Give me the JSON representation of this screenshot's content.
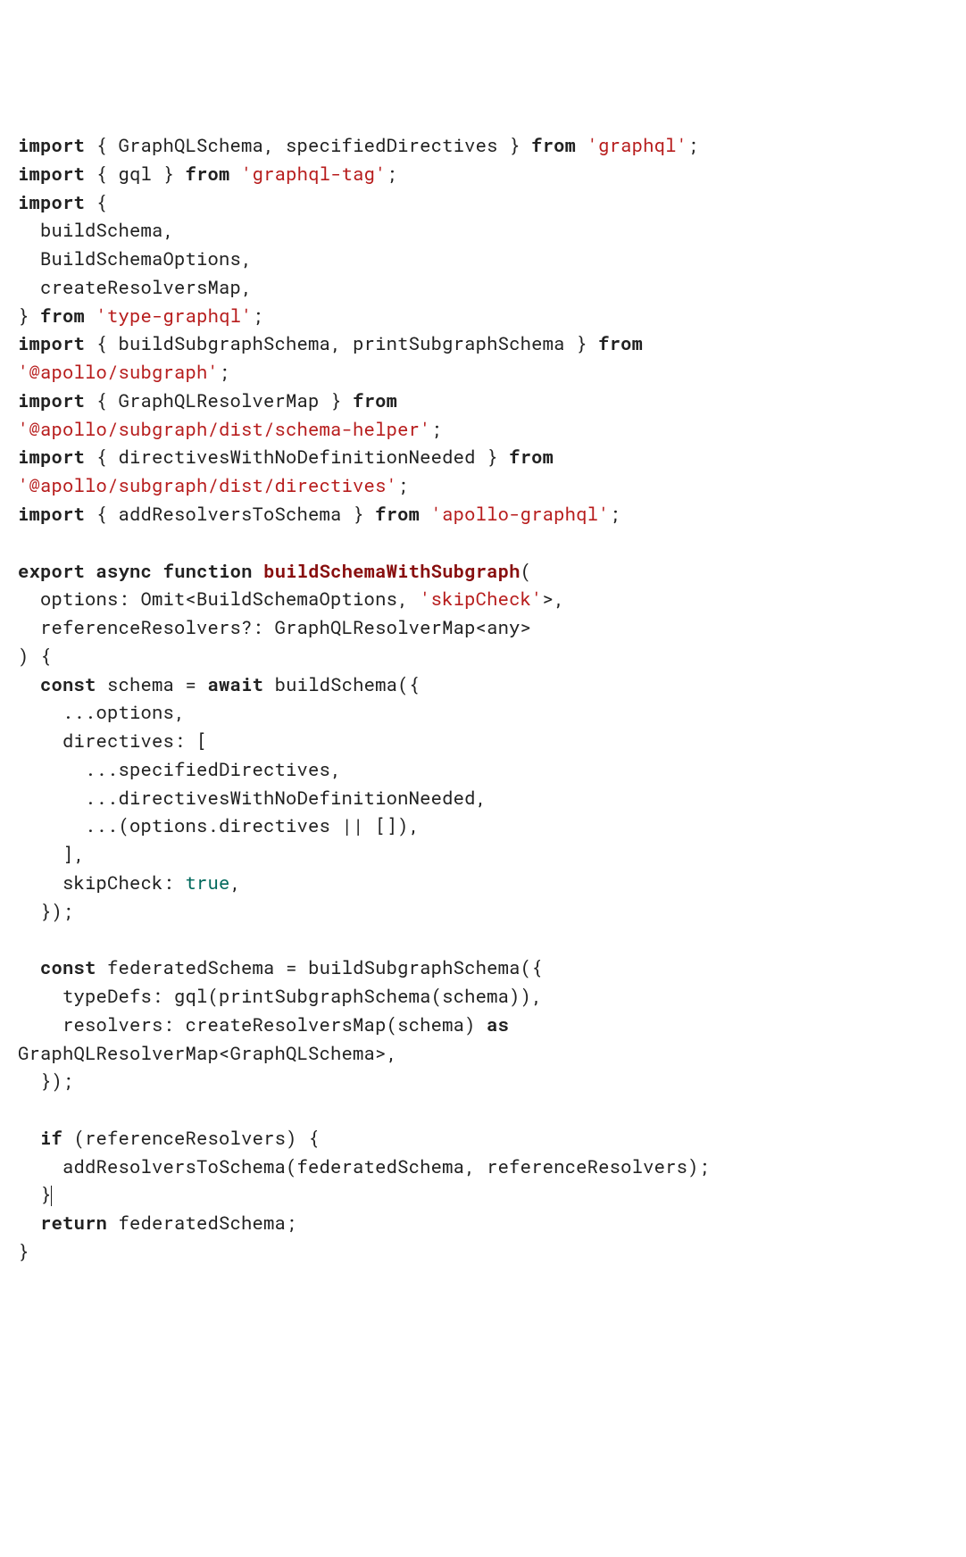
{
  "tokens": [
    {
      "t": "import",
      "c": "kw"
    },
    {
      "t": " { GraphQLSchema, specifiedDirectives } ",
      "c": ""
    },
    {
      "t": "from",
      "c": "kw"
    },
    {
      "t": " ",
      "c": ""
    },
    {
      "t": "'graphql'",
      "c": "str"
    },
    {
      "t": ";",
      "c": ""
    },
    {
      "t": "\n",
      "c": ""
    },
    {
      "t": "import",
      "c": "kw"
    },
    {
      "t": " { gql } ",
      "c": ""
    },
    {
      "t": "from",
      "c": "kw"
    },
    {
      "t": " ",
      "c": ""
    },
    {
      "t": "'graphql-tag'",
      "c": "str"
    },
    {
      "t": ";",
      "c": ""
    },
    {
      "t": "\n",
      "c": ""
    },
    {
      "t": "import",
      "c": "kw"
    },
    {
      "t": " {",
      "c": ""
    },
    {
      "t": "\n",
      "c": ""
    },
    {
      "t": "  buildSchema,",
      "c": ""
    },
    {
      "t": "\n",
      "c": ""
    },
    {
      "t": "  BuildSchemaOptions,",
      "c": ""
    },
    {
      "t": "\n",
      "c": ""
    },
    {
      "t": "  createResolversMap,",
      "c": ""
    },
    {
      "t": "\n",
      "c": ""
    },
    {
      "t": "} ",
      "c": ""
    },
    {
      "t": "from",
      "c": "kw"
    },
    {
      "t": " ",
      "c": ""
    },
    {
      "t": "'type-graphql'",
      "c": "str"
    },
    {
      "t": ";",
      "c": ""
    },
    {
      "t": "\n",
      "c": ""
    },
    {
      "t": "import",
      "c": "kw"
    },
    {
      "t": " { buildSubgraphSchema, printSubgraphSchema } ",
      "c": ""
    },
    {
      "t": "from",
      "c": "kw"
    },
    {
      "t": "\n",
      "c": ""
    },
    {
      "t": "'@apollo/subgraph'",
      "c": "str"
    },
    {
      "t": ";",
      "c": ""
    },
    {
      "t": "\n",
      "c": ""
    },
    {
      "t": "import",
      "c": "kw"
    },
    {
      "t": " { GraphQLResolverMap } ",
      "c": ""
    },
    {
      "t": "from",
      "c": "kw"
    },
    {
      "t": "\n",
      "c": ""
    },
    {
      "t": "'@apollo/subgraph/dist/schema-helper'",
      "c": "str"
    },
    {
      "t": ";",
      "c": ""
    },
    {
      "t": "\n",
      "c": ""
    },
    {
      "t": "import",
      "c": "kw"
    },
    {
      "t": " { directivesWithNoDefinitionNeeded } ",
      "c": ""
    },
    {
      "t": "from",
      "c": "kw"
    },
    {
      "t": "\n",
      "c": ""
    },
    {
      "t": "'@apollo/subgraph/dist/directives'",
      "c": "str"
    },
    {
      "t": ";",
      "c": ""
    },
    {
      "t": "\n",
      "c": ""
    },
    {
      "t": "import",
      "c": "kw"
    },
    {
      "t": " { addResolversToSchema } ",
      "c": ""
    },
    {
      "t": "from",
      "c": "kw"
    },
    {
      "t": " ",
      "c": ""
    },
    {
      "t": "'apollo-graphql'",
      "c": "str"
    },
    {
      "t": ";",
      "c": ""
    },
    {
      "t": "\n",
      "c": ""
    },
    {
      "t": "\n",
      "c": ""
    },
    {
      "t": "export",
      "c": "kw"
    },
    {
      "t": " ",
      "c": ""
    },
    {
      "t": "async",
      "c": "kw"
    },
    {
      "t": " ",
      "c": ""
    },
    {
      "t": "function",
      "c": "kw"
    },
    {
      "t": " ",
      "c": ""
    },
    {
      "t": "buildSchemaWithSubgraph",
      "c": "fn"
    },
    {
      "t": "(",
      "c": ""
    },
    {
      "t": "\n",
      "c": ""
    },
    {
      "t": "  options: Omit<BuildSchemaOptions, ",
      "c": ""
    },
    {
      "t": "'skipCheck'",
      "c": "str"
    },
    {
      "t": ">,",
      "c": ""
    },
    {
      "t": "\n",
      "c": ""
    },
    {
      "t": "  referenceResolvers?: GraphQLResolverMap<any>",
      "c": ""
    },
    {
      "t": "\n",
      "c": ""
    },
    {
      "t": ") {",
      "c": ""
    },
    {
      "t": "\n",
      "c": ""
    },
    {
      "t": "  ",
      "c": ""
    },
    {
      "t": "const",
      "c": "kw"
    },
    {
      "t": " schema = ",
      "c": ""
    },
    {
      "t": "await",
      "c": "kw"
    },
    {
      "t": " buildSchema({",
      "c": ""
    },
    {
      "t": "\n",
      "c": ""
    },
    {
      "t": "    ...options,",
      "c": ""
    },
    {
      "t": "\n",
      "c": ""
    },
    {
      "t": "    directives: [",
      "c": ""
    },
    {
      "t": "\n",
      "c": ""
    },
    {
      "t": "      ...specifiedDirectives,",
      "c": ""
    },
    {
      "t": "\n",
      "c": ""
    },
    {
      "t": "      ...directivesWithNoDefinitionNeeded,",
      "c": ""
    },
    {
      "t": "\n",
      "c": ""
    },
    {
      "t": "      ...(options.directives || []),",
      "c": ""
    },
    {
      "t": "\n",
      "c": ""
    },
    {
      "t": "    ],",
      "c": ""
    },
    {
      "t": "\n",
      "c": ""
    },
    {
      "t": "    skipCheck: ",
      "c": ""
    },
    {
      "t": "true",
      "c": "bool"
    },
    {
      "t": ",",
      "c": ""
    },
    {
      "t": "\n",
      "c": ""
    },
    {
      "t": "  });",
      "c": ""
    },
    {
      "t": "\n",
      "c": ""
    },
    {
      "t": "\n",
      "c": ""
    },
    {
      "t": "  ",
      "c": ""
    },
    {
      "t": "const",
      "c": "kw"
    },
    {
      "t": " federatedSchema = buildSubgraphSchema({",
      "c": ""
    },
    {
      "t": "\n",
      "c": ""
    },
    {
      "t": "    typeDefs: gql(printSubgraphSchema(schema)),",
      "c": ""
    },
    {
      "t": "\n",
      "c": ""
    },
    {
      "t": "    resolvers: createResolversMap(schema) ",
      "c": ""
    },
    {
      "t": "as",
      "c": "kw"
    },
    {
      "t": "\n",
      "c": ""
    },
    {
      "t": "GraphQLResolverMap<GraphQLSchema>,",
      "c": ""
    },
    {
      "t": "\n",
      "c": ""
    },
    {
      "t": "  });",
      "c": ""
    },
    {
      "t": "\n",
      "c": ""
    },
    {
      "t": "\n",
      "c": ""
    },
    {
      "t": "  ",
      "c": ""
    },
    {
      "t": "if",
      "c": "kw"
    },
    {
      "t": " (referenceResolvers) {",
      "c": ""
    },
    {
      "t": "\n",
      "c": ""
    },
    {
      "t": "    addResolversToSchema(federatedSchema, referenceResolvers);",
      "c": ""
    },
    {
      "t": "\n",
      "c": ""
    },
    {
      "t": "  }",
      "c": ""
    },
    {
      "t": "CURSOR",
      "c": "cursor"
    },
    {
      "t": "\n",
      "c": ""
    },
    {
      "t": "  ",
      "c": ""
    },
    {
      "t": "return",
      "c": "kw"
    },
    {
      "t": " federatedSchema;",
      "c": ""
    },
    {
      "t": "\n",
      "c": ""
    },
    {
      "t": "}",
      "c": ""
    }
  ]
}
